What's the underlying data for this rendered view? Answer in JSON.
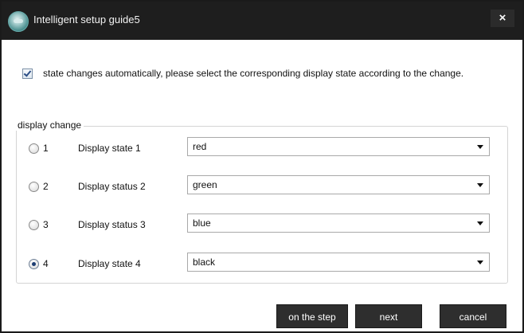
{
  "window": {
    "title": "Intelligent setup guide5",
    "close_label": "×"
  },
  "auto_option": {
    "checked": true,
    "label": "state changes automatically, please select the corresponding display state according to the change."
  },
  "group": {
    "legend": "display change",
    "rows": [
      {
        "radio_label": "1",
        "state_label": "Display state 1",
        "value": "red",
        "selected": false
      },
      {
        "radio_label": "2",
        "state_label": "Display status 2",
        "value": "green",
        "selected": false
      },
      {
        "radio_label": "3",
        "state_label": "Display status 3",
        "value": "blue",
        "selected": false
      },
      {
        "radio_label": "4",
        "state_label": "Display state 4",
        "value": "black",
        "selected": true
      }
    ]
  },
  "buttons": {
    "prev_label": "on the step",
    "next_label": "next",
    "cancel_label": "cancel"
  },
  "colors": {
    "titlebar": "#1e1e1e",
    "button": "#2e2e2e"
  }
}
